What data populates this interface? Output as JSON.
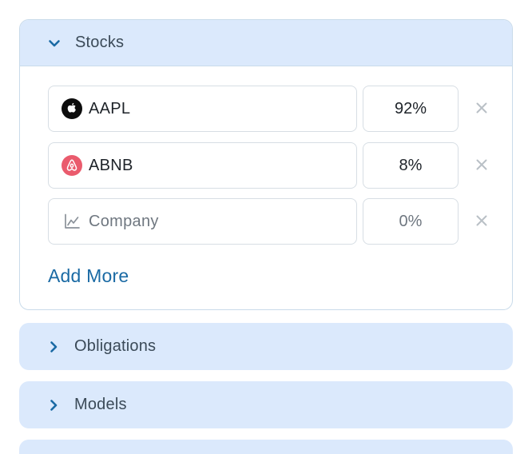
{
  "sections": {
    "stocks": {
      "label": "Stocks",
      "expanded": true,
      "rows": [
        {
          "company": "AAPL",
          "percent": "92%",
          "logo": "apple-icon"
        },
        {
          "company": "ABNB",
          "percent": "8%",
          "logo": "airbnb-icon"
        }
      ],
      "empty_row": {
        "company_placeholder": "Company",
        "percent_placeholder": "0%",
        "icon": "line-chart-icon"
      },
      "add_more_label": "Add More"
    },
    "obligations": {
      "label": "Obligations",
      "expanded": false
    },
    "models": {
      "label": "Models",
      "expanded": false
    }
  },
  "colors": {
    "section_header_bg": "#dbe9fc",
    "accent_link": "#1a6aa4",
    "chevron": "#1a6aa4",
    "border": "#d7dee4",
    "remove_icon": "#b9c0c6",
    "airbnb_logo_bg": "#ea5b6d",
    "apple_logo_bg": "#0d0d0d"
  }
}
